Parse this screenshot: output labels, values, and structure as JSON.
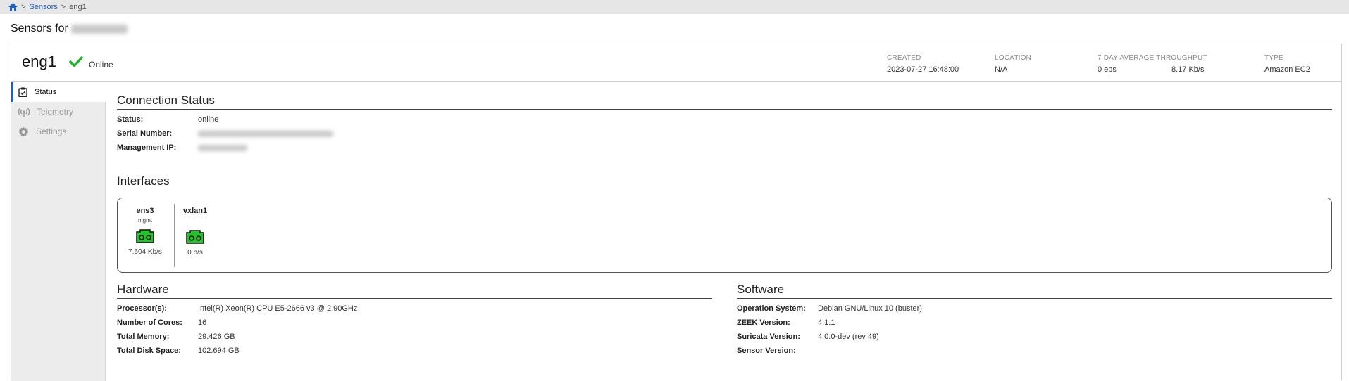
{
  "breadcrumb": {
    "sep1": ">",
    "sensors": "Sensors",
    "sep2": ">",
    "current": "eng1"
  },
  "page_title": "Sensors for",
  "sensor": {
    "name": "eng1",
    "status_text": "Online"
  },
  "meta": [
    {
      "label": "CREATED",
      "value": "2023-07-27 16:48:00"
    },
    {
      "label": "LOCATION",
      "value": "N/A"
    },
    {
      "label": "7 DAY AVERAGE THROUGHPUT",
      "value1": "0 eps",
      "value2": "8.17 Kb/s"
    },
    {
      "label": "TYPE",
      "value": "Amazon EC2"
    }
  ],
  "sidebar": [
    {
      "label": "Status",
      "icon": "clipboard-check-icon",
      "active": true
    },
    {
      "label": "Telemetry",
      "icon": "broadcast-icon",
      "active": false
    },
    {
      "label": "Settings",
      "icon": "gear-icon",
      "active": false
    }
  ],
  "connection": {
    "title": "Connection Status",
    "rows": [
      {
        "k": "Status:",
        "v": "online"
      },
      {
        "k": "Serial Number:",
        "v": ""
      },
      {
        "k": "Management IP:",
        "v": ""
      }
    ]
  },
  "interfaces": {
    "title": "Interfaces",
    "items": [
      {
        "name": "ens3",
        "sub": "mgmt",
        "rate": "7.604 Kb/s"
      },
      {
        "name": "vxlan1",
        "sub": "",
        "rate": "0 b/s"
      }
    ]
  },
  "hardware": {
    "title": "Hardware",
    "rows": [
      {
        "k": "Processor(s):",
        "v": "Intel(R) Xeon(R) CPU E5-2666 v3 @ 2.90GHz"
      },
      {
        "k": "Number of Cores:",
        "v": "16"
      },
      {
        "k": "Total Memory:",
        "v": "29.426 GB"
      },
      {
        "k": "Total Disk Space:",
        "v": "102.694 GB"
      }
    ]
  },
  "software": {
    "title": "Software",
    "rows": [
      {
        "k": "Operation System:",
        "v": "Debian GNU/Linux 10 (buster)"
      },
      {
        "k": "ZEEK Version:",
        "v": "4.1.1"
      },
      {
        "k": "Suricata Version:",
        "v": "4.0.0-dev (rev 49)"
      },
      {
        "k": "Sensor Version:",
        "v": ""
      }
    ]
  },
  "colors": {
    "accent": "#1f5fbf",
    "online": "#1fb52a",
    "port": "#22c42a"
  }
}
